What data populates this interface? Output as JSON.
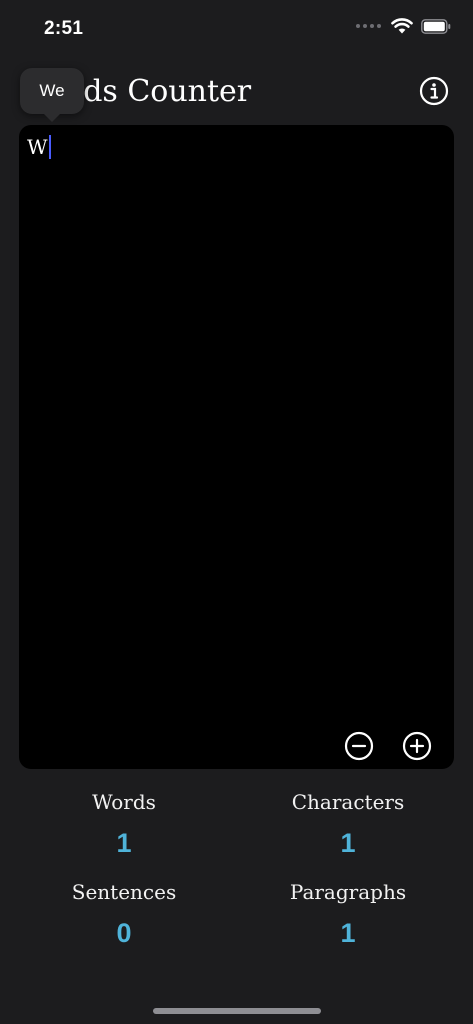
{
  "status_bar": {
    "time": "2:51",
    "wifi_icon": "wifi-icon",
    "battery_icon": "battery-icon"
  },
  "header": {
    "title": "Words Counter",
    "info_icon": "info-icon"
  },
  "autocomplete": {
    "suggestion": "We"
  },
  "editor": {
    "text": "W",
    "zoom_out_icon": "minus-circle-icon",
    "zoom_in_icon": "plus-circle-icon"
  },
  "stats": {
    "words_label": "Words",
    "words_value": "1",
    "characters_label": "Characters",
    "characters_value": "1",
    "sentences_label": "Sentences",
    "sentences_value": "0",
    "paragraphs_label": "Paragraphs",
    "paragraphs_value": "1"
  },
  "colors": {
    "background": "#1c1c1e",
    "editor_background": "#000000",
    "accent": "#4fb3d9",
    "caret": "#4a5cff"
  }
}
